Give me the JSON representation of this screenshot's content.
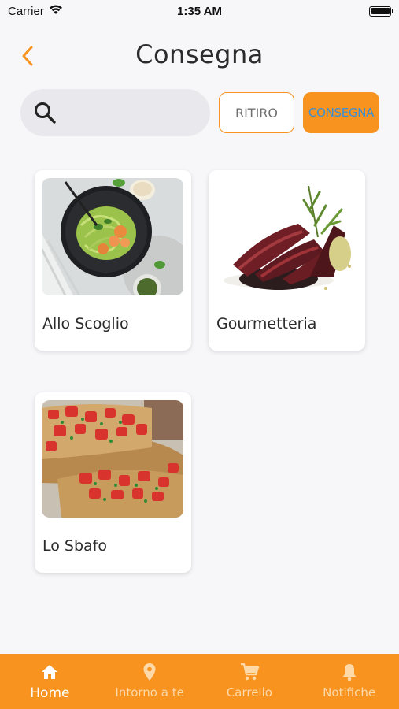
{
  "status_bar": {
    "carrier": "Carrier",
    "time": "1:35 AM"
  },
  "header": {
    "title": "Consegna",
    "back_icon": "chevron-left-icon"
  },
  "filters": {
    "search_placeholder": "",
    "search_value": "",
    "options": [
      {
        "label": "RITIRO",
        "selected": false
      },
      {
        "label": "CONSEGNA",
        "selected": true
      }
    ]
  },
  "restaurants": [
    {
      "name": "Allo Scoglio",
      "image": "pasta-with-shrimp-photo"
    },
    {
      "name": "Gourmetteria",
      "image": "sliced-steak-photo"
    },
    {
      "name": "Lo Sbafo",
      "image": "bruschetta-photo"
    }
  ],
  "tabbar": {
    "items": [
      {
        "label": "Home",
        "icon": "home-icon",
        "active": true
      },
      {
        "label": "Intorno a te",
        "icon": "location-pin-icon",
        "active": false
      },
      {
        "label": "Carrello",
        "icon": "cart-icon",
        "active": false
      },
      {
        "label": "Notifiche",
        "icon": "bell-icon",
        "active": false
      }
    ]
  },
  "colors": {
    "accent": "#f7931e",
    "background": "#f7f6f9",
    "consegna_text": "#3c8fd0"
  }
}
